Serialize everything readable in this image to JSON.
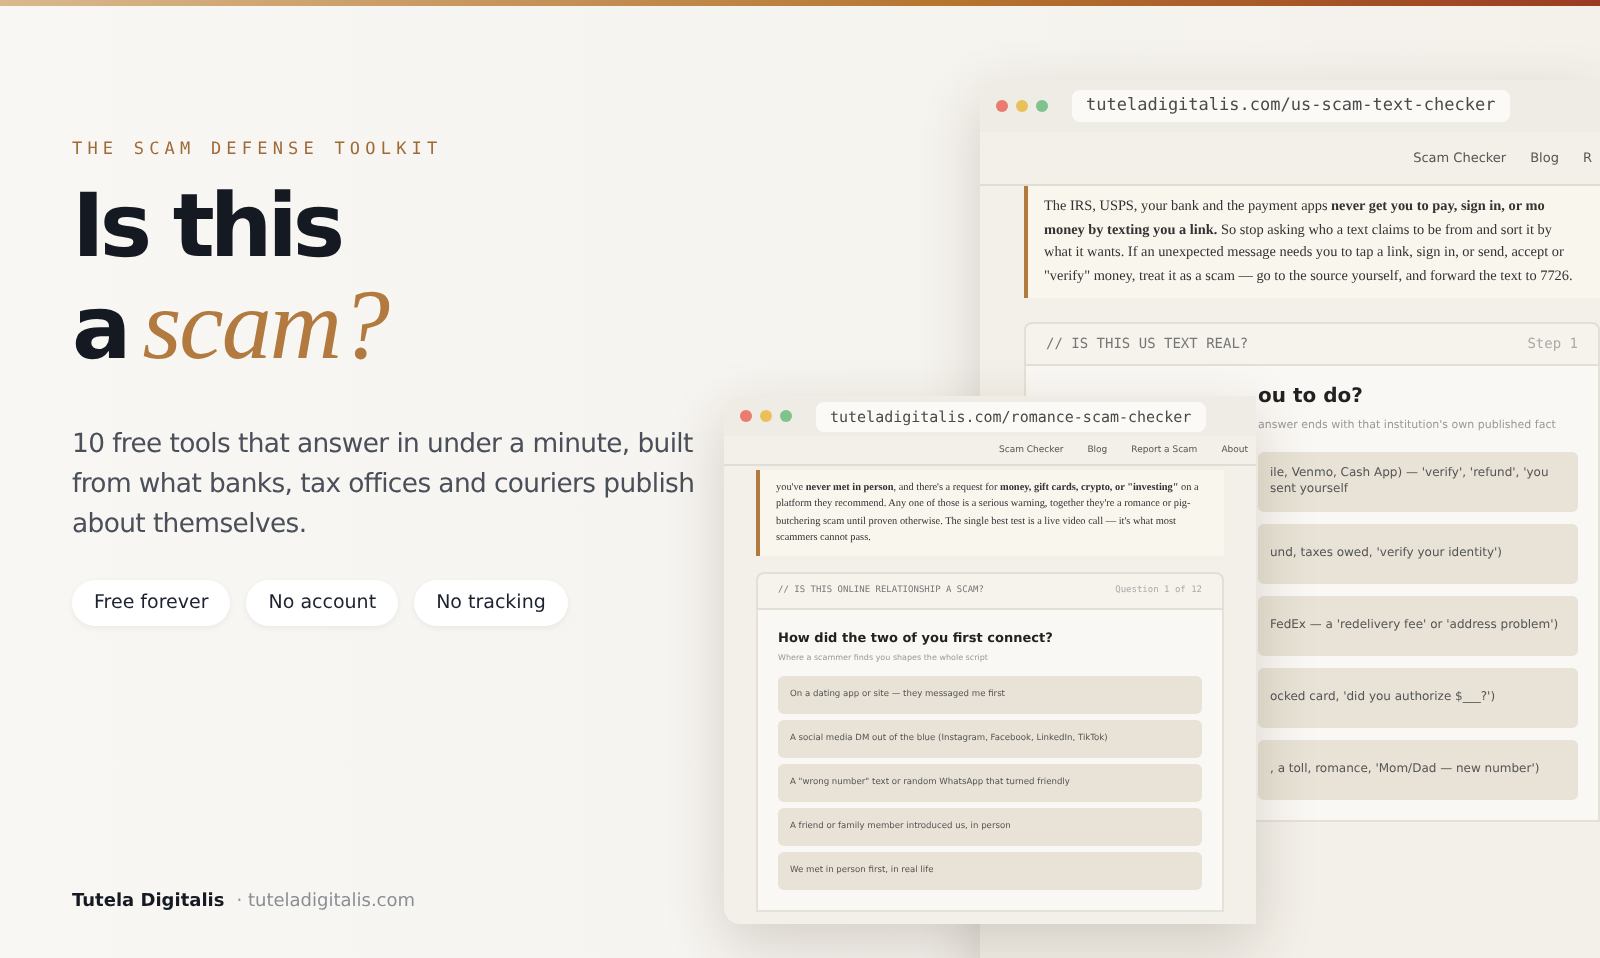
{
  "eyebrow": "THE SCAM DEFENSE TOOLKIT",
  "headline": {
    "line1": "Is this",
    "line2": "a",
    "accent": "scam?"
  },
  "intro": "10 free tools that answer in under a minute, built from what banks, tax offices and couriers publish about themselves.",
  "pills": [
    "Free forever",
    "No account",
    "No tracking"
  ],
  "footer": {
    "brand": "Tutela Digitalis",
    "site": "· tuteladigitalis.com"
  },
  "back_window": {
    "url": "tuteladigitalis.com/us-scam-text-checker",
    "nav": [
      "Scam Checker",
      "Blog",
      "R"
    ],
    "lines": [
      "The IRS, USPS, your bank and the payment apps **never get you to pay, sign in, or mo**",
      "**money by texting you a link.** So stop asking who a text claims to be from and sort it by",
      "what it wants. If an unexpected message needs you to tap a link, sign in, or send, accept or",
      "\"verify\" money, treat it as a scam — go to the source yourself, and forward the text to 7726."
    ],
    "card_title": "// IS THIS US TEXT REAL?",
    "step": "Step 1",
    "question": "ou to do?",
    "hint": "answer ends with that institution's own published fact",
    "options": [
      "ile, Venmo, Cash App) — 'verify', 'refund', 'you sent yourself",
      "und, taxes owed, 'verify your identity')",
      "FedEx — a 'redelivery fee' or 'address problem')",
      "ocked card, 'did you authorize $___?')",
      ", a toll, romance, 'Mom/Dad — new number')"
    ]
  },
  "front_window": {
    "url": "tuteladigitalis.com/romance-scam-checker",
    "nav": [
      "Scam Checker",
      "Blog",
      "Report a Scam",
      "About"
    ],
    "quote": "you've **never met in person**, and there's a request for **money, gift cards, crypto, or \"investing\"** on a platform they recommend. Any one of those is a serious warning, together they're a romance or pig-butchering scam until proven otherwise. The single best test is a live video call — it's what most scammers cannot pass.",
    "card_title": "// IS THIS ONLINE RELATIONSHIP A SCAM?",
    "step": "Question 1 of 12",
    "question": "How did the two of you first connect?",
    "hint": "Where a scammer finds you shapes the whole script",
    "options": [
      "On a dating app or site — they messaged me first",
      "A social media DM out of the blue (Instagram, Facebook, LinkedIn, TikTok)",
      "A \"wrong number\" text or random WhatsApp that turned friendly",
      "A friend or family member introduced us, in person",
      "We met in person first, in real life"
    ]
  }
}
